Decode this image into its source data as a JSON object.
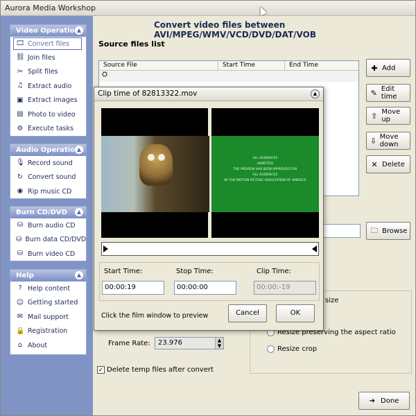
{
  "app": {
    "title": "Aurora Media Workshop"
  },
  "sidebar": {
    "groups": [
      {
        "title": "Video Operations",
        "items": [
          {
            "label": "Convert files",
            "icon": "film-icon"
          },
          {
            "label": "Join files",
            "icon": "join-icon"
          },
          {
            "label": "Split files",
            "icon": "split-icon"
          },
          {
            "label": "Extract audio",
            "icon": "note-icon"
          },
          {
            "label": "Extract images",
            "icon": "image-icon"
          },
          {
            "label": "Photo to video",
            "icon": "photo-icon"
          },
          {
            "label": "Execute tasks",
            "icon": "gear-icon"
          }
        ]
      },
      {
        "title": "Audio Operations",
        "items": [
          {
            "label": "Record sound",
            "icon": "mic-icon"
          },
          {
            "label": "Convert sound",
            "icon": "refresh-icon"
          },
          {
            "label": "Rip music CD",
            "icon": "cd-icon"
          }
        ]
      },
      {
        "title": "Burn CD/DVD",
        "items": [
          {
            "label": "Burn audio CD",
            "icon": "burn-icon"
          },
          {
            "label": "Burn data CD/DVD",
            "icon": "burn-icon"
          },
          {
            "label": "Burn video CD",
            "icon": "burn-icon"
          }
        ]
      },
      {
        "title": "Help",
        "items": [
          {
            "label": "Help content",
            "icon": "help-icon"
          },
          {
            "label": "Getting started",
            "icon": "smile-icon"
          },
          {
            "label": "Mail support",
            "icon": "mail-icon"
          },
          {
            "label": "Registration",
            "icon": "lock-icon"
          },
          {
            "label": "About",
            "icon": "home-icon"
          }
        ]
      }
    ]
  },
  "main": {
    "title": "Convert video files between AVI/MPEG/WMV/VCD/DVD/DAT/VOB",
    "source_files_label": "Source files list",
    "columns": [
      "Source File",
      "Start Time",
      "End Time"
    ],
    "buttons": {
      "add": "Add",
      "edit_time": "Edit time",
      "move_up": "Move up",
      "move_down": "Move down",
      "delete": "Delete",
      "browse": "Browse",
      "done": "Done"
    },
    "frame_rate_label": "Frame Rate:",
    "frame_rate_value": "23.976",
    "resize_partial": "size",
    "resize_preserve": "Resize preserving the aspect ratio",
    "resize_crop": "Resize crop",
    "delete_temp_label": "Delete temp files after convert"
  },
  "dialog": {
    "title": "Clip time of 82813322.mov",
    "preview_text": [
      "ALL AUDIENCES",
      "ADMITTED",
      "THE PREVIEW HAS BEEN APPROVED FOR",
      "ALL AUDIENCES",
      "BY THE MOTION PICTURE ASSOCIATION OF AMERICA"
    ],
    "start_time_label": "Start Time:",
    "stop_time_label": "Stop Time:",
    "clip_time_label": "Clip Time:",
    "start_time": "00:00:19",
    "stop_time": "00:00:00",
    "clip_time": "00:00:-19",
    "hint": "Click the film window to preview",
    "cancel": "Cancel",
    "ok": "OK"
  }
}
